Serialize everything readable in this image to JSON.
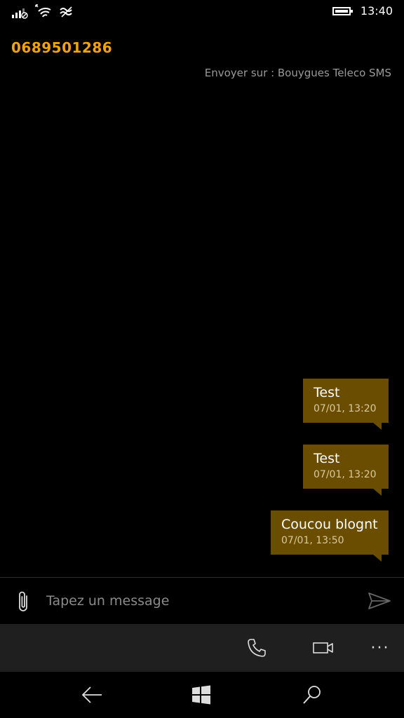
{
  "status": {
    "time": "13:40",
    "icons": [
      "signal-icon",
      "wifi-icon",
      "data-sense-icon",
      "battery-icon"
    ]
  },
  "header": {
    "contact": "0689501286",
    "send_via": "Envoyer sur : Bouygues Teleco SMS"
  },
  "messages": [
    {
      "text": "Test",
      "timestamp": "07/01, 13:20"
    },
    {
      "text": "Test",
      "timestamp": "07/01, 13:20"
    },
    {
      "text": "Coucou blognt",
      "timestamp": "07/01, 13:50"
    }
  ],
  "compose": {
    "placeholder": "Tapez un message",
    "value": ""
  },
  "appbar": {
    "more_label": "···"
  },
  "colors": {
    "accent": "#f0a30a",
    "bubble": "#6b4d00",
    "appbar": "#1f1f1f"
  }
}
